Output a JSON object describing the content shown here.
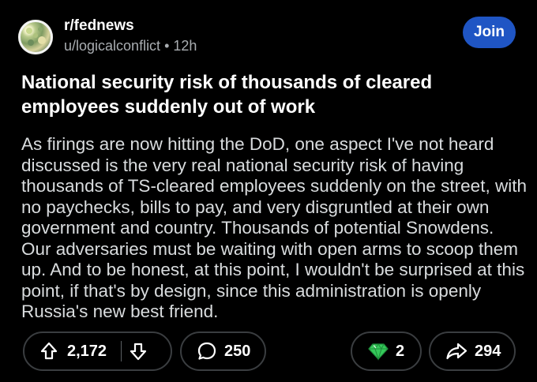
{
  "post": {
    "subreddit": "r/fednews",
    "author": "u/logicalconflict",
    "separator": "•",
    "age": "12h",
    "join_label": "Join",
    "title": "National security risk of thousands of cleared employees suddenly out of work",
    "body": "As firings are now hitting the DoD, one aspect I've not heard discussed is the very real national security risk of having thousands of TS-cleared employees suddenly on the street, with no paychecks, bills to pay, and very disgruntled at their own government and country. Thousands of potential Snowdens. Our adversaries must be waiting with open arms to scoop them up. And to be honest, at this point, I wouldn't be surprised at this point, if that's by design, since this administration is openly Russia's new best friend."
  },
  "actions": {
    "upvotes": "2,172",
    "comments": "250",
    "awards": "2",
    "shares": "294"
  },
  "icons": {
    "avatar": "subreddit-avatar",
    "upvote": "upvote-arrow-icon",
    "downvote": "downvote-arrow-icon",
    "comment": "comment-bubble-icon",
    "award": "gem-award-icon",
    "share": "share-arrow-icon"
  },
  "colors": {
    "background": "#000000",
    "join_button": "#1f55c4",
    "award_green": "#35c95a",
    "pill_border": "#3a3d40"
  }
}
